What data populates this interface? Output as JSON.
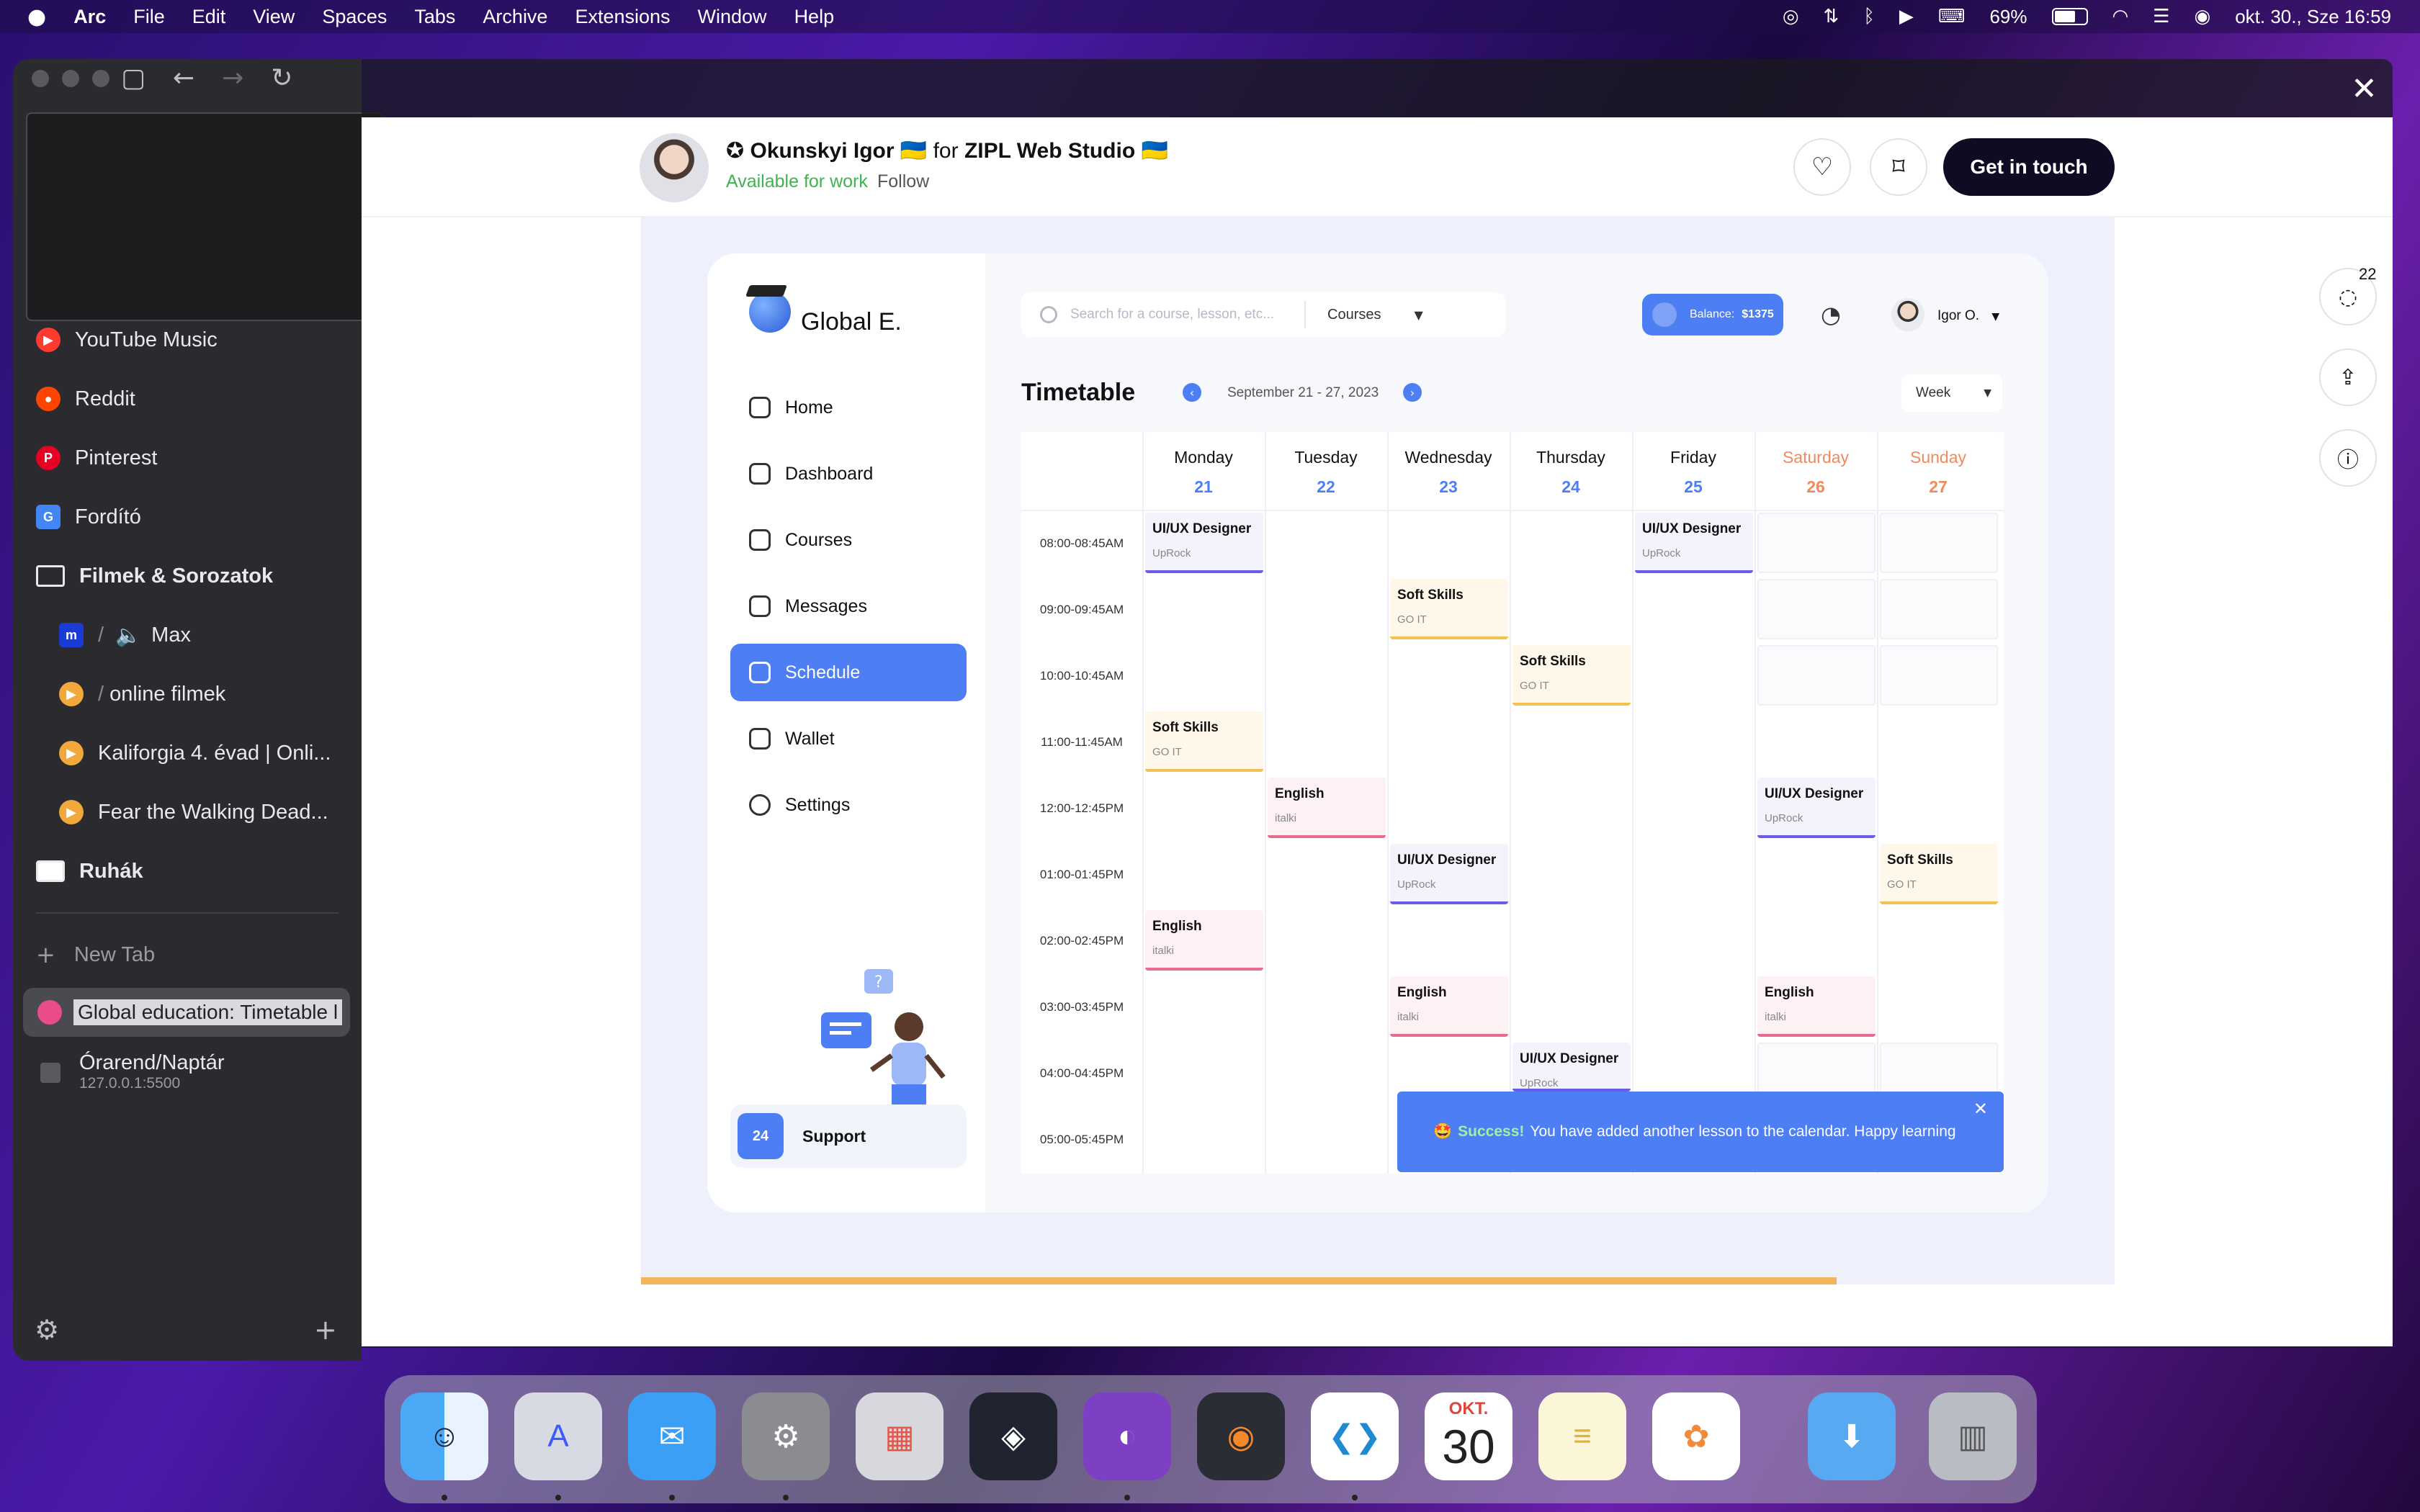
{
  "menubar": {
    "apple": "",
    "app": "Arc",
    "items": [
      "File",
      "Edit",
      "View",
      "Spaces",
      "Tabs",
      "Archive",
      "Extensions",
      "Window",
      "Help"
    ],
    "battery": "69%",
    "datetime": "okt. 30., Sze  16:59"
  },
  "sidebar": {
    "items": [
      {
        "label": "YouTube Music",
        "color": "#ff3b30"
      },
      {
        "label": "Reddit",
        "color": "#ff4500"
      },
      {
        "label": "Pinterest",
        "color": "#e60023"
      },
      {
        "label": "Fordító",
        "color": "#4285f4"
      },
      {
        "label": "Filmek & Sorozatok"
      },
      {
        "label": "Max",
        "prefix": "m"
      },
      {
        "label": "online filmek"
      },
      {
        "label": "Kaliforgia 4. évad | Onli..."
      },
      {
        "label": "Fear the Walking Dead..."
      },
      {
        "label": "Ruhák"
      }
    ],
    "new_tab": "New Tab",
    "active_tab": "Global education: Timetable l",
    "other_tab": {
      "title": "Órarend/Naptár",
      "url": "127.0.0.1:5500"
    }
  },
  "dribbble": {
    "author": "Okunskyi Igor",
    "for": "for",
    "studio": "ZIPL Web Studio",
    "flag": "🇺🇦",
    "available": "Available for work",
    "follow": "Follow",
    "cta": "Get in touch",
    "comments_badge": "22"
  },
  "app": {
    "brand": "Global E.",
    "nav": [
      "Home",
      "Dashboard",
      "Courses",
      "Messages",
      "Schedule",
      "Wallet",
      "Settings"
    ],
    "active_nav": "Schedule",
    "support": "Support",
    "support_icon_text": "24",
    "search_placeholder": "Search for a course, lesson, etc...",
    "search_category": "Courses",
    "balance_label": "Balance:",
    "balance_value": "$1375",
    "user": "Igor O.",
    "title": "Timetable",
    "date_range": "September 21 - 27, 2023",
    "view": "Week",
    "days": [
      {
        "name": "Monday",
        "date": "21"
      },
      {
        "name": "Tuesday",
        "date": "22"
      },
      {
        "name": "Wednesday",
        "date": "23"
      },
      {
        "name": "Thursday",
        "date": "24"
      },
      {
        "name": "Friday",
        "date": "25"
      },
      {
        "name": "Saturday",
        "date": "26"
      },
      {
        "name": "Sunday",
        "date": "27"
      }
    ],
    "times": [
      "08:00-08:45AM",
      "09:00-09:45AM",
      "10:00-10:45AM",
      "11:00-11:45AM",
      "12:00-12:45PM",
      "01:00-01:45PM",
      "02:00-02:45PM",
      "03:00-03:45PM",
      "04:00-04:45PM",
      "05:00-05:45PM"
    ],
    "events": [
      {
        "title": "UI/UX Designer",
        "sub": "UpRock",
        "kind": "ux"
      },
      {
        "title": "UI/UX Designer",
        "sub": "UpRock",
        "kind": "ux"
      },
      {
        "title": "Soft Skills",
        "sub": "GO IT",
        "kind": "ss"
      },
      {
        "title": "Soft Skills",
        "sub": "GO IT",
        "kind": "ss"
      },
      {
        "title": "Soft Skills",
        "sub": "GO IT",
        "kind": "ss"
      },
      {
        "title": "English",
        "sub": "italki",
        "kind": "en"
      },
      {
        "title": "UI/UX Designer",
        "sub": "UpRock",
        "kind": "ux"
      },
      {
        "title": "UI/UX Designer",
        "sub": "UpRock",
        "kind": "ux"
      },
      {
        "title": "Soft Skills",
        "sub": "GO IT",
        "kind": "ss"
      },
      {
        "title": "English",
        "sub": "italki",
        "kind": "en"
      },
      {
        "title": "English",
        "sub": "italki",
        "kind": "en"
      },
      {
        "title": "English",
        "sub": "italki",
        "kind": "en"
      },
      {
        "title": "UI/UX Designer",
        "sub": "UpRock",
        "kind": "ux"
      }
    ],
    "toast": {
      "emoji": "🤩",
      "success": "Success!",
      "message": "You have added another lesson to the calendar. Happy learning"
    }
  },
  "dock": {
    "calendar_month": "OKT.",
    "calendar_day": "30"
  }
}
